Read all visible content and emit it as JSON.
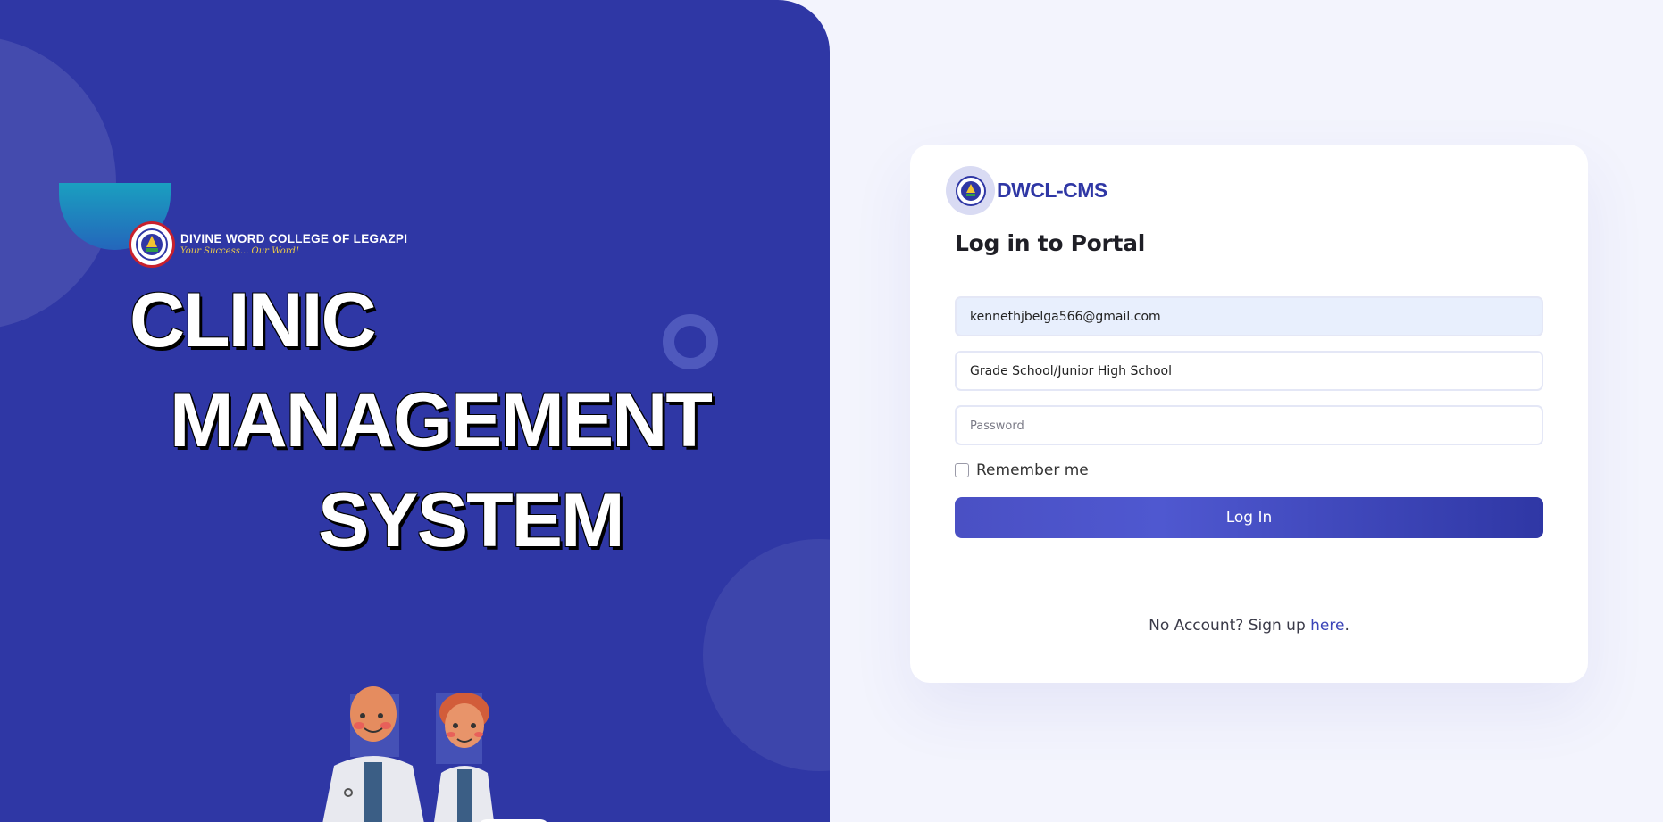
{
  "brand": {
    "college_name": "DIVINE WORD COLLEGE OF LEGAZPI",
    "college_tagline": "Your Success... Our Word!",
    "hero_lines": [
      "CLINIC",
      "MANAGEMENT",
      "SYSTEM"
    ]
  },
  "login": {
    "brand_name": "DWCL-CMS",
    "title": "Log in to Portal",
    "email_value": "kennethjbelga566@gmail.com",
    "department_value": "Grade School/Junior High School",
    "password_placeholder": "Password",
    "remember_label": "Remember me",
    "button_label": "Log In",
    "signup_prefix": "No Account? Sign up ",
    "signup_link": "here",
    "signup_suffix": "."
  },
  "colors": {
    "primary": "#2f37a5",
    "background": "#f3f4fd",
    "accent_gradient_start": "#4a50c4"
  }
}
